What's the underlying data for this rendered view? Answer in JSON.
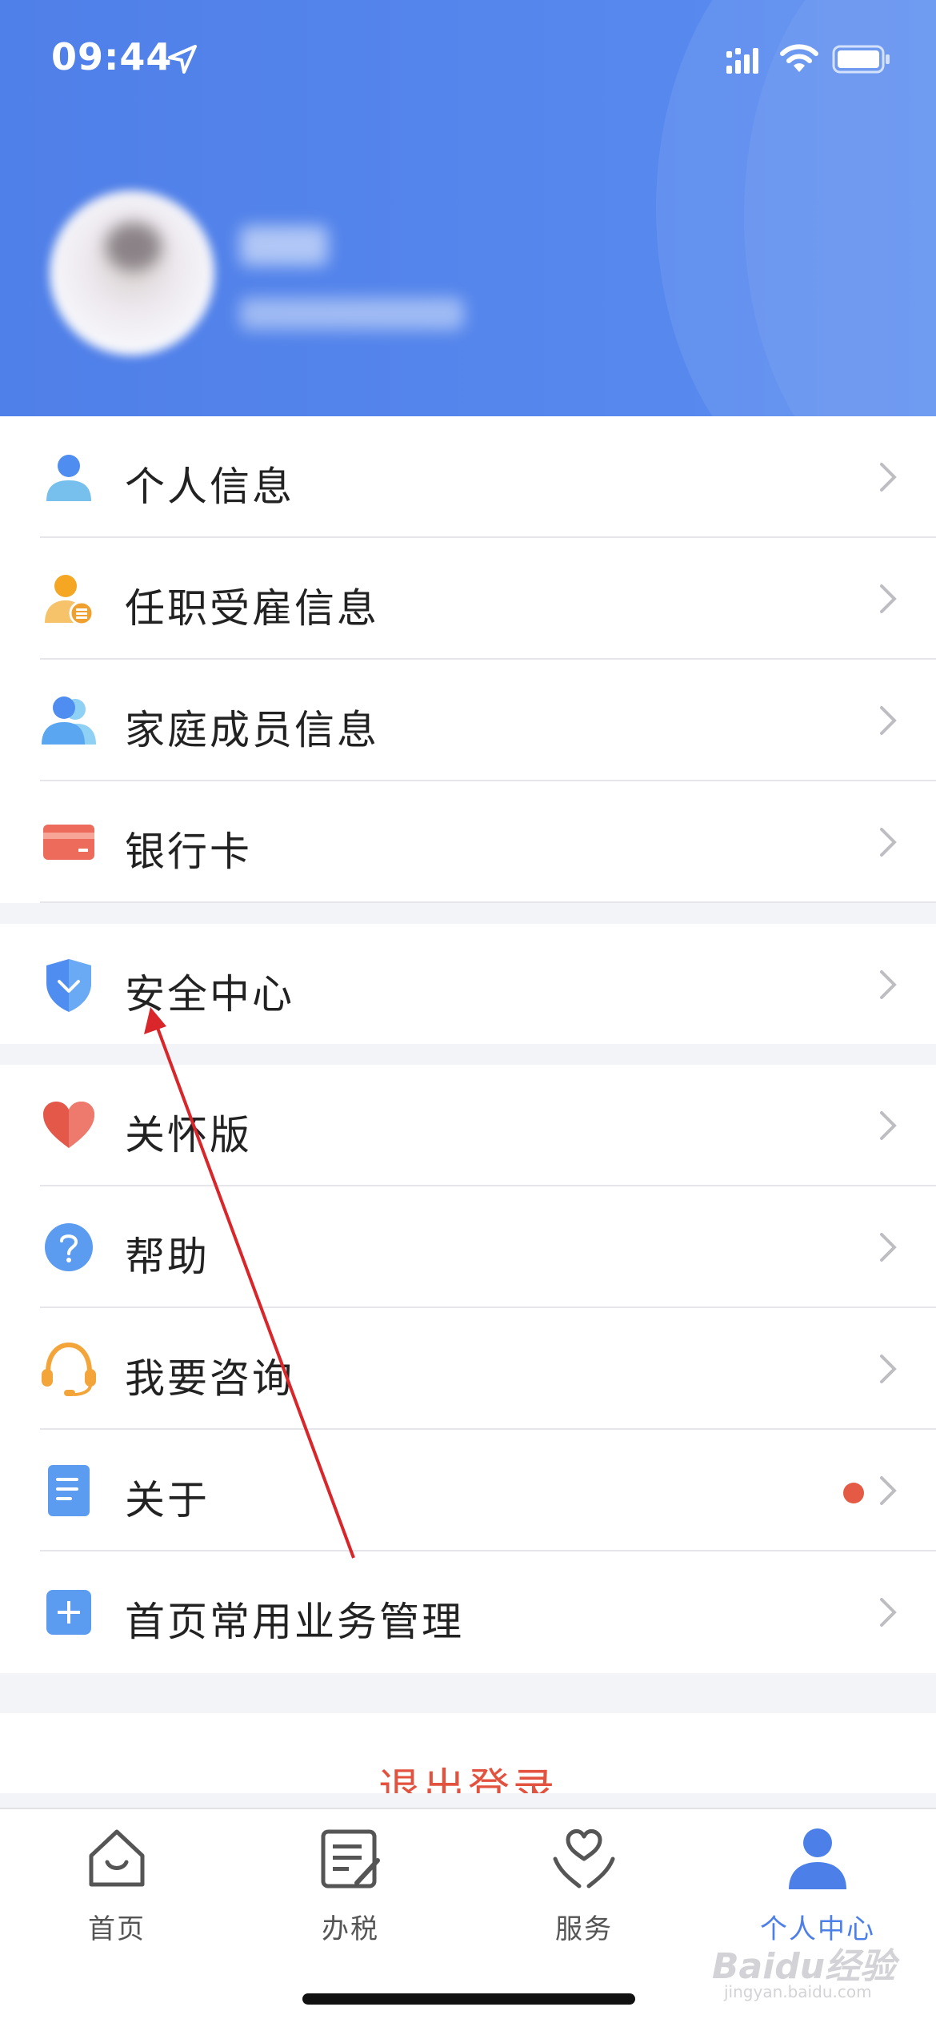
{
  "status_bar": {
    "time": "09:44"
  },
  "menu_group_1": [
    {
      "label": "个人信息",
      "icon": "person-icon"
    },
    {
      "label": "任职受雇信息",
      "icon": "employment-icon"
    },
    {
      "label": "家庭成员信息",
      "icon": "family-icon"
    },
    {
      "label": "银行卡",
      "icon": "bank-card-icon"
    }
  ],
  "menu_group_2": [
    {
      "label": "安全中心",
      "icon": "shield-icon"
    }
  ],
  "menu_group_3": [
    {
      "label": "关怀版",
      "icon": "heart-icon"
    },
    {
      "label": "帮助",
      "icon": "help-icon"
    },
    {
      "label": "我要咨询",
      "icon": "headset-icon"
    },
    {
      "label": "关于",
      "icon": "document-icon",
      "badge": true
    },
    {
      "label": "首页常用业务管理",
      "icon": "plus-square-icon"
    }
  ],
  "logout_label": "退出登录",
  "tabbar": [
    {
      "label": "首页",
      "icon": "home-icon",
      "active": false
    },
    {
      "label": "办税",
      "icon": "tax-edit-icon",
      "active": false
    },
    {
      "label": "服务",
      "icon": "service-heart-icon",
      "active": false
    },
    {
      "label": "个人中心",
      "icon": "user-center-icon",
      "active": true
    }
  ],
  "watermark": {
    "brand": "Baidu经验",
    "url": "jingyan.baidu.com"
  },
  "colors": {
    "header_blue": "#5a8cf0",
    "accent": "#4c7fe8",
    "logout_red": "#e2523f",
    "badge_red": "#e45a45"
  }
}
